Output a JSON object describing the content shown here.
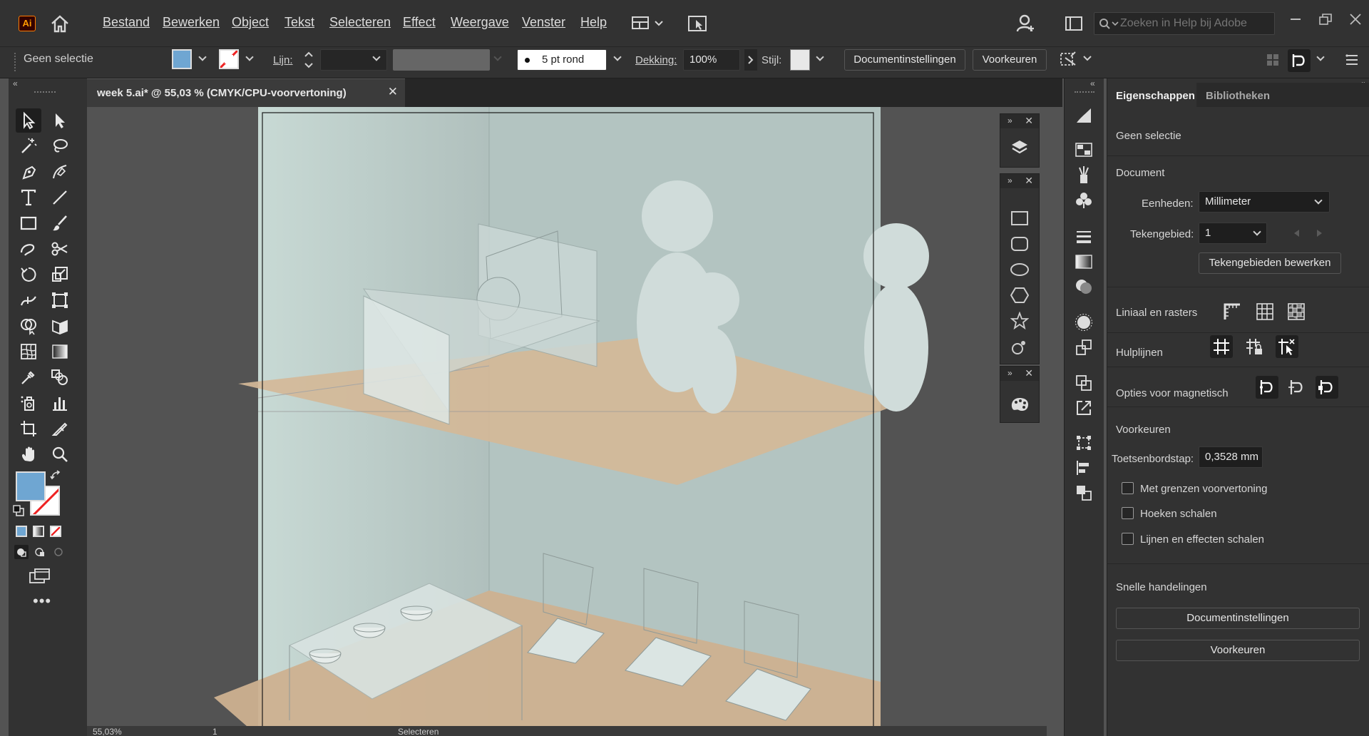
{
  "menubar": {
    "app_logo": "Ai",
    "items": [
      "Bestand",
      "Bewerken",
      "Object",
      "Tekst",
      "Selecteren",
      "Effect",
      "Weergave",
      "Venster",
      "Help"
    ],
    "search_placeholder": "Zoeken in Help bij Adobe"
  },
  "controlbar": {
    "selection_label": "Geen selectie",
    "fill_color": "#6fa6d2",
    "stroke_label": "Lijn:",
    "brush_value": "5 pt rond",
    "opacity_label": "Dekking:",
    "opacity_value": "100%",
    "style_label": "Stijl:",
    "doc_settings_button": "Documentinstellingen",
    "preferences_button": "Voorkeuren"
  },
  "document_tab": {
    "title": "week 5.ai* @ 55,03 % (CMYK/CPU-voorvertoning)"
  },
  "statusbar": {
    "zoom": "55,03%",
    "artboard": "1",
    "tool_name": "Selecteren"
  },
  "properties_panel": {
    "tabs": [
      "Eigenschappen",
      "Bibliotheken"
    ],
    "selection": "Geen selectie",
    "document_heading": "Document",
    "units_label": "Eenheden:",
    "units_value": "Millimeter",
    "artboard_label": "Tekengebied:",
    "artboard_value": "1",
    "edit_artboards_button": "Tekengebieden bewerken",
    "rulers_label": "Liniaal en rasters",
    "guides_label": "Hulplijnen",
    "snap_label": "Opties voor magnetisch",
    "preferences_heading": "Voorkeuren",
    "keyboard_increment_label": "Toetsenbordstap:",
    "keyboard_increment_value": "0,3528 mm",
    "checkboxes": [
      "Met grenzen voorvertoning",
      "Hoeken schalen",
      "Lijnen en effecten schalen"
    ],
    "quick_actions_heading": "Snelle handelingen",
    "quick_doc_settings": "Documentinstellingen",
    "quick_preferences": "Voorkeuren"
  },
  "colors": {
    "accent": "#6fa6d2",
    "ui_dark": "#323232",
    "canvas_gray": "#535353",
    "floor": "#d1b697",
    "wall": "#b7c8c4"
  }
}
